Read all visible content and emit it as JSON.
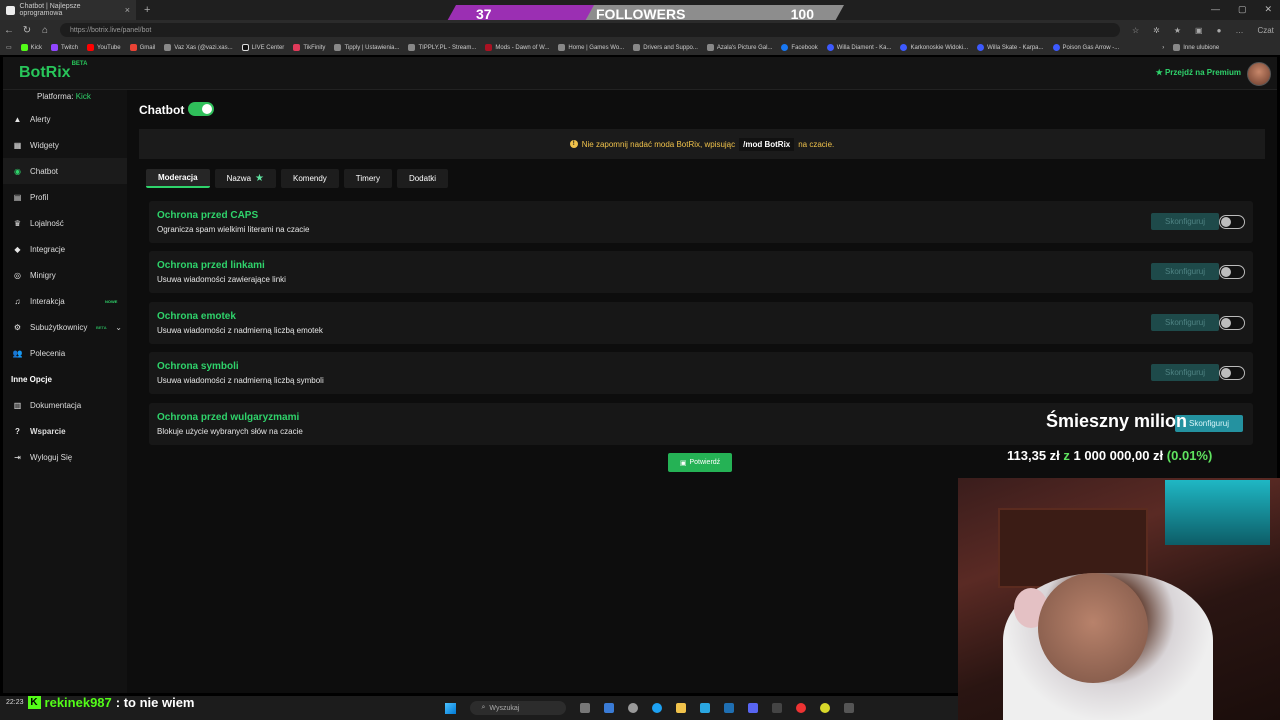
{
  "browser": {
    "tab_title": "Chatbot | Najlepsze oprogramowa",
    "url": "https://botrix.live/panel/bot",
    "bookmarks": [
      "Kick",
      "Twitch",
      "YouTube",
      "Gmail",
      "Vaz Xas (@vazi.xas...",
      "LIVE Center",
      "TikFinity",
      "Tipply | Ustawienia...",
      "TIPPLY.PL - Stream...",
      "Mods - Dawn of W...",
      "Home | Games Wo...",
      "Drivers and Suppo...",
      "Azala's Picture Gal...",
      "Facebook",
      "Willa Diament - Ka...",
      "Karkonoskie Widoki...",
      "Willa Skate - Karpa...",
      "Poison Gas Arrow -..."
    ],
    "bookmarks_other": "Inne ulubione",
    "copilot": "Czat"
  },
  "followers": {
    "current": "37",
    "label": "FOLLOWERS",
    "goal": "100"
  },
  "app": {
    "logo": "BotRix",
    "logo_badge": "BETA",
    "premium_label": "Przejdź na Premium",
    "platform_label": "Platforma:",
    "platform_value": "Kick",
    "sidebar": {
      "items": [
        {
          "label": "Alerty",
          "icon": "warning-icon"
        },
        {
          "label": "Widgety",
          "icon": "grid-icon"
        },
        {
          "label": "Chatbot",
          "icon": "robot-icon"
        },
        {
          "label": "Profil",
          "icon": "id-card-icon"
        },
        {
          "label": "Lojalność",
          "icon": "trophy-icon"
        },
        {
          "label": "Integracje",
          "icon": "plug-icon"
        },
        {
          "label": "Minigry",
          "icon": "gamepad-icon"
        },
        {
          "label": "Interakcja",
          "icon": "music-icon",
          "badge": "NOWE"
        },
        {
          "label": "Subużytkownicy",
          "icon": "users-cog-icon",
          "badge": "BETA"
        },
        {
          "label": "Polecenia",
          "icon": "users-icon"
        }
      ],
      "section_title": "Inne Opcje",
      "other_items": [
        {
          "label": "Dokumentacja",
          "icon": "book-icon"
        },
        {
          "label": "Wsparcie",
          "icon": "question-icon"
        },
        {
          "label": "Wyloguj Się",
          "icon": "logout-icon"
        }
      ]
    },
    "page_title": "Chatbot",
    "notice": {
      "before": "Nie zapomnij nadać moda BotRix, wpisując",
      "command": "/mod BotRix",
      "after": "na czacie."
    },
    "tabs": [
      "Moderacja",
      "Nazwa",
      "Komendy",
      "Timery",
      "Dodatki"
    ],
    "configure_label": "Skonfiguruj",
    "cards": [
      {
        "title": "Ochrona przed CAPS",
        "desc": "Ogranicza spam wielkimi literami na czacie"
      },
      {
        "title": "Ochrona przed linkami",
        "desc": "Usuwa wiadomości zawierające linki"
      },
      {
        "title": "Ochrona emotek",
        "desc": "Usuwa wiadomości z nadmierną liczbą emotek"
      },
      {
        "title": "Ochrona symboli",
        "desc": "Usuwa wiadomości z nadmierną liczbą symboli"
      },
      {
        "title": "Ochrona przed wulgaryzmami",
        "desc": "Blokuje użycie wybranych słów na czacie"
      }
    ],
    "confirm_label": "Potwierdź"
  },
  "overlay": {
    "goal_title": "Śmieszny milion",
    "current": "113,35 zł",
    "z": "z",
    "target": "1 000 000,00 zł",
    "percent": "(0.01%)",
    "progress_fraction": 0.0001
  },
  "chat": {
    "time": "22:23",
    "user": "rekinek987",
    "message": ": to nie wiem"
  },
  "taskbar": {
    "search_placeholder": "Wyszukaj"
  },
  "colors": {
    "accent": "#2fd36b",
    "followers_bar": "#9b2fb3",
    "warning": "#f0c24b",
    "configure": "#1e4a4a"
  }
}
